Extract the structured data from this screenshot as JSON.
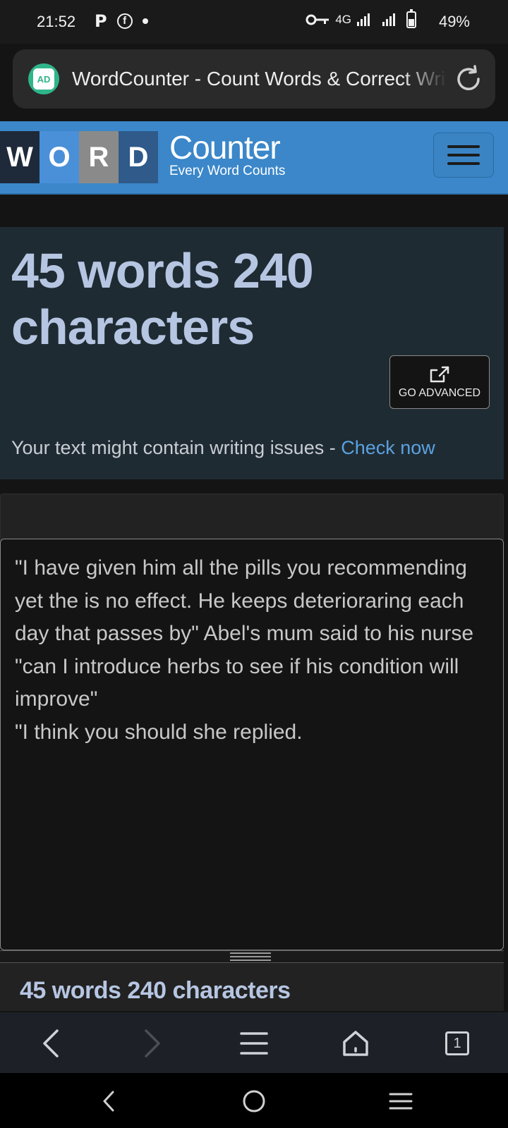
{
  "status_bar": {
    "time": "21:52",
    "left_icons": [
      "p-icon",
      "facebook-icon",
      "dot-icon"
    ],
    "p_glyph": "P",
    "fb_glyph": "f",
    "network": "4G",
    "battery": "49%"
  },
  "browser": {
    "tab_title": "WordCounter - Count Words & Correct Writing",
    "ad_badge": "AD"
  },
  "site": {
    "logo_letters": [
      "W",
      "O",
      "R",
      "D"
    ],
    "logo_name": "Counter",
    "tagline": "Every Word Counts"
  },
  "stats": {
    "headline": "45 words 240 characters",
    "go_advanced": "GO ADVANCED",
    "issues_prefix": "Your text might contain writing issues - ",
    "check_now": "Check now"
  },
  "editor": {
    "text": "\"I have given him all the pills you recommending yet the is no effect. He keeps deterioraring each day that passes by\" Abel's mum said to his nurse\n\"can I introduce herbs to see if his condition will improve\"\n\"I think you should she replied."
  },
  "footer_stats": {
    "summary": "45 words 240 characters"
  },
  "browser_nav": {
    "tab_count": "1"
  },
  "colors": {
    "header_blue": "#3b87c9",
    "stats_text": "#b6c6e2",
    "link_blue": "#5aa2e0",
    "card_bg": "#1f2b33"
  }
}
